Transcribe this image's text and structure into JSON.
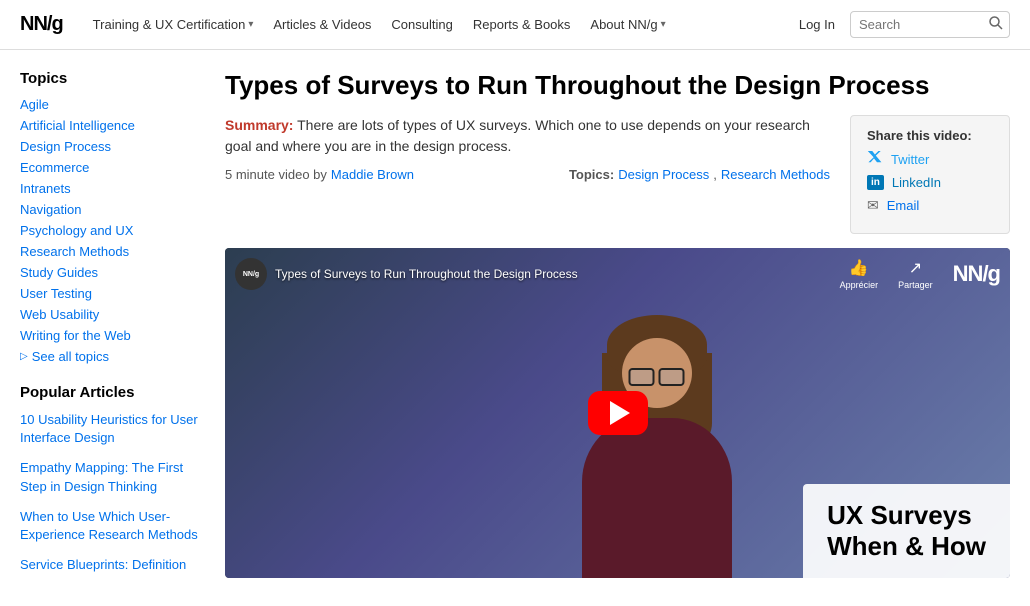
{
  "logo": {
    "text": "NN/g",
    "slash": "/"
  },
  "nav": {
    "items": [
      {
        "label": "Training & UX Certification",
        "hasChevron": true
      },
      {
        "label": "Articles & Videos",
        "hasChevron": false
      },
      {
        "label": "Consulting",
        "hasChevron": false
      },
      {
        "label": "Reports & Books",
        "hasChevron": false
      },
      {
        "label": "About NN/g",
        "hasChevron": true
      }
    ],
    "login": "Log In",
    "search_placeholder": "Search"
  },
  "sidebar": {
    "topics_title": "Topics",
    "topics": [
      {
        "label": "Agile"
      },
      {
        "label": "Artificial Intelligence"
      },
      {
        "label": "Design Process"
      },
      {
        "label": "Ecommerce"
      },
      {
        "label": "Intranets"
      },
      {
        "label": "Navigation"
      },
      {
        "label": "Psychology and UX"
      },
      {
        "label": "Research Methods"
      },
      {
        "label": "Study Guides"
      },
      {
        "label": "User Testing"
      },
      {
        "label": "Web Usability"
      },
      {
        "label": "Writing for the Web"
      }
    ],
    "see_all": "See all topics",
    "popular_title": "Popular Articles",
    "popular_articles": [
      {
        "label": "10 Usability Heuristics for User Interface Design"
      },
      {
        "label": "Empathy Mapping: The First Step in Design Thinking"
      },
      {
        "label": "When to Use Which User-Experience Research Methods"
      },
      {
        "label": "Service Blueprints: Definition"
      }
    ]
  },
  "article": {
    "title": "Types of Surveys to Run Throughout the Design Process",
    "summary_label": "Summary:",
    "summary_text": " There are lots of types of UX surveys. Which one to use depends on your research goal and where you are in the design process.",
    "meta": {
      "duration": "5 minute video by",
      "author": "Maddie Brown",
      "topics_label": "Topics:",
      "topic1": "Design Process",
      "topic2": "Research Methods"
    },
    "share": {
      "title": "Share this video:",
      "twitter": "Twitter",
      "linkedin": "LinkedIn",
      "email": "Email"
    },
    "video": {
      "badge_text": "NN/g",
      "title": "Types of Surveys to Run Throughout the Design Process",
      "action1": "Apprécier",
      "action2": "Partager",
      "logo": "NN/g",
      "overlay_title_line1": "UX Surveys",
      "overlay_title_line2": "When & How"
    }
  }
}
